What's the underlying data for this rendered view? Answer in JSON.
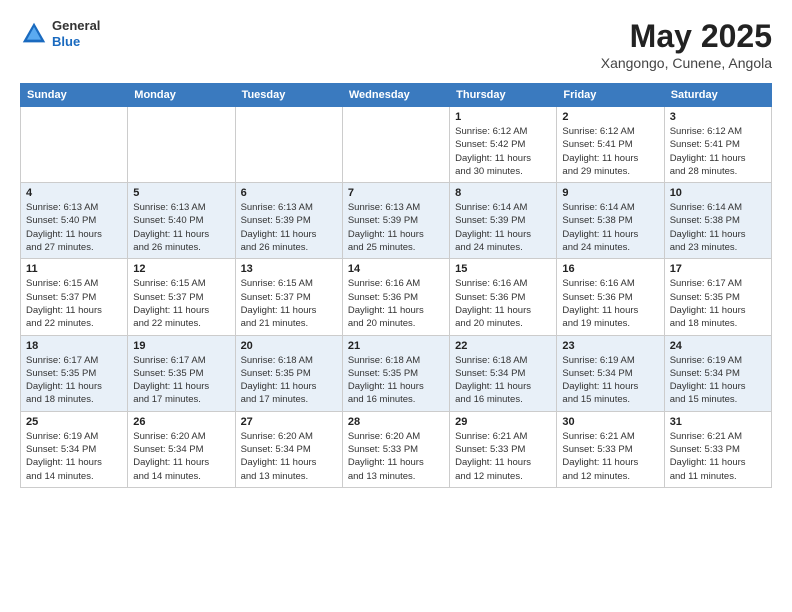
{
  "header": {
    "logo_line1": "General",
    "logo_line2": "Blue",
    "title": "May 2025",
    "subtitle": "Xangongo, Cunene, Angola"
  },
  "weekdays": [
    "Sunday",
    "Monday",
    "Tuesday",
    "Wednesday",
    "Thursday",
    "Friday",
    "Saturday"
  ],
  "weeks": [
    [
      {
        "day": "",
        "info": ""
      },
      {
        "day": "",
        "info": ""
      },
      {
        "day": "",
        "info": ""
      },
      {
        "day": "",
        "info": ""
      },
      {
        "day": "1",
        "info": "Sunrise: 6:12 AM\nSunset: 5:42 PM\nDaylight: 11 hours\nand 30 minutes."
      },
      {
        "day": "2",
        "info": "Sunrise: 6:12 AM\nSunset: 5:41 PM\nDaylight: 11 hours\nand 29 minutes."
      },
      {
        "day": "3",
        "info": "Sunrise: 6:12 AM\nSunset: 5:41 PM\nDaylight: 11 hours\nand 28 minutes."
      }
    ],
    [
      {
        "day": "4",
        "info": "Sunrise: 6:13 AM\nSunset: 5:40 PM\nDaylight: 11 hours\nand 27 minutes."
      },
      {
        "day": "5",
        "info": "Sunrise: 6:13 AM\nSunset: 5:40 PM\nDaylight: 11 hours\nand 26 minutes."
      },
      {
        "day": "6",
        "info": "Sunrise: 6:13 AM\nSunset: 5:39 PM\nDaylight: 11 hours\nand 26 minutes."
      },
      {
        "day": "7",
        "info": "Sunrise: 6:13 AM\nSunset: 5:39 PM\nDaylight: 11 hours\nand 25 minutes."
      },
      {
        "day": "8",
        "info": "Sunrise: 6:14 AM\nSunset: 5:39 PM\nDaylight: 11 hours\nand 24 minutes."
      },
      {
        "day": "9",
        "info": "Sunrise: 6:14 AM\nSunset: 5:38 PM\nDaylight: 11 hours\nand 24 minutes."
      },
      {
        "day": "10",
        "info": "Sunrise: 6:14 AM\nSunset: 5:38 PM\nDaylight: 11 hours\nand 23 minutes."
      }
    ],
    [
      {
        "day": "11",
        "info": "Sunrise: 6:15 AM\nSunset: 5:37 PM\nDaylight: 11 hours\nand 22 minutes."
      },
      {
        "day": "12",
        "info": "Sunrise: 6:15 AM\nSunset: 5:37 PM\nDaylight: 11 hours\nand 22 minutes."
      },
      {
        "day": "13",
        "info": "Sunrise: 6:15 AM\nSunset: 5:37 PM\nDaylight: 11 hours\nand 21 minutes."
      },
      {
        "day": "14",
        "info": "Sunrise: 6:16 AM\nSunset: 5:36 PM\nDaylight: 11 hours\nand 20 minutes."
      },
      {
        "day": "15",
        "info": "Sunrise: 6:16 AM\nSunset: 5:36 PM\nDaylight: 11 hours\nand 20 minutes."
      },
      {
        "day": "16",
        "info": "Sunrise: 6:16 AM\nSunset: 5:36 PM\nDaylight: 11 hours\nand 19 minutes."
      },
      {
        "day": "17",
        "info": "Sunrise: 6:17 AM\nSunset: 5:35 PM\nDaylight: 11 hours\nand 18 minutes."
      }
    ],
    [
      {
        "day": "18",
        "info": "Sunrise: 6:17 AM\nSunset: 5:35 PM\nDaylight: 11 hours\nand 18 minutes."
      },
      {
        "day": "19",
        "info": "Sunrise: 6:17 AM\nSunset: 5:35 PM\nDaylight: 11 hours\nand 17 minutes."
      },
      {
        "day": "20",
        "info": "Sunrise: 6:18 AM\nSunset: 5:35 PM\nDaylight: 11 hours\nand 17 minutes."
      },
      {
        "day": "21",
        "info": "Sunrise: 6:18 AM\nSunset: 5:35 PM\nDaylight: 11 hours\nand 16 minutes."
      },
      {
        "day": "22",
        "info": "Sunrise: 6:18 AM\nSunset: 5:34 PM\nDaylight: 11 hours\nand 16 minutes."
      },
      {
        "day": "23",
        "info": "Sunrise: 6:19 AM\nSunset: 5:34 PM\nDaylight: 11 hours\nand 15 minutes."
      },
      {
        "day": "24",
        "info": "Sunrise: 6:19 AM\nSunset: 5:34 PM\nDaylight: 11 hours\nand 15 minutes."
      }
    ],
    [
      {
        "day": "25",
        "info": "Sunrise: 6:19 AM\nSunset: 5:34 PM\nDaylight: 11 hours\nand 14 minutes."
      },
      {
        "day": "26",
        "info": "Sunrise: 6:20 AM\nSunset: 5:34 PM\nDaylight: 11 hours\nand 14 minutes."
      },
      {
        "day": "27",
        "info": "Sunrise: 6:20 AM\nSunset: 5:34 PM\nDaylight: 11 hours\nand 13 minutes."
      },
      {
        "day": "28",
        "info": "Sunrise: 6:20 AM\nSunset: 5:33 PM\nDaylight: 11 hours\nand 13 minutes."
      },
      {
        "day": "29",
        "info": "Sunrise: 6:21 AM\nSunset: 5:33 PM\nDaylight: 11 hours\nand 12 minutes."
      },
      {
        "day": "30",
        "info": "Sunrise: 6:21 AM\nSunset: 5:33 PM\nDaylight: 11 hours\nand 12 minutes."
      },
      {
        "day": "31",
        "info": "Sunrise: 6:21 AM\nSunset: 5:33 PM\nDaylight: 11 hours\nand 11 minutes."
      }
    ]
  ],
  "colors": {
    "header_bg": "#3a7abf",
    "row_alt": "#e8f0f8"
  }
}
